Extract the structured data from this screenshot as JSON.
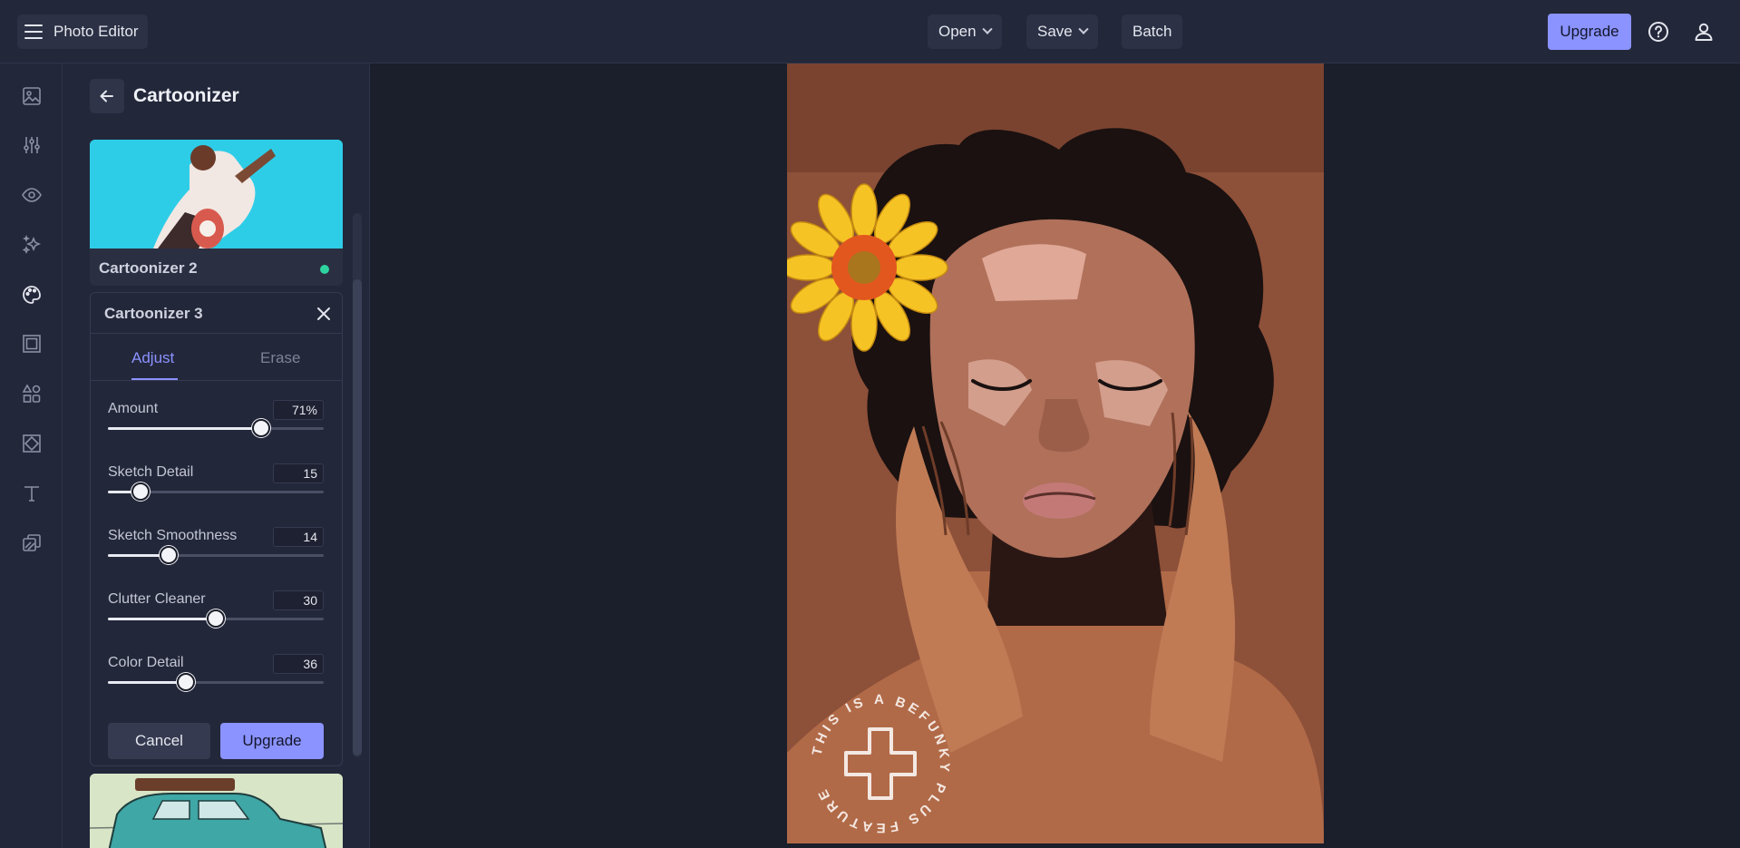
{
  "app": {
    "title": "Photo Editor"
  },
  "toolbar": {
    "open_label": "Open",
    "save_label": "Save",
    "batch_label": "Batch",
    "upgrade_label": "Upgrade"
  },
  "panel": {
    "title": "Cartoonizer",
    "preset_above": {
      "label": "Cartoonizer 2"
    },
    "active_preset": {
      "title": "Cartoonizer 3",
      "tabs": [
        "Adjust",
        "Erase"
      ],
      "active_tab": "Adjust",
      "sliders": [
        {
          "label": "Amount",
          "value": 71,
          "display": "71%",
          "min": 0,
          "max": 100
        },
        {
          "label": "Sketch Detail",
          "value": 15,
          "display": "15",
          "min": 0,
          "max": 100
        },
        {
          "label": "Sketch Smoothness",
          "value": 14,
          "display": "14",
          "min": 0,
          "max": 50
        },
        {
          "label": "Clutter Cleaner",
          "value": 30,
          "display": "30",
          "min": 0,
          "max": 60
        },
        {
          "label": "Color Detail",
          "value": 36,
          "display": "36",
          "min": 0,
          "max": 100
        }
      ],
      "cancel_label": "Cancel",
      "upgrade_label": "Upgrade"
    }
  },
  "watermark": {
    "text": "THIS IS A BEFUNKY PLUS FEATURE"
  },
  "colors": {
    "accent": "#8a93ff",
    "active_dot": "#2fd3a0",
    "background": "#1b1e2b",
    "panel": "#23273a"
  }
}
